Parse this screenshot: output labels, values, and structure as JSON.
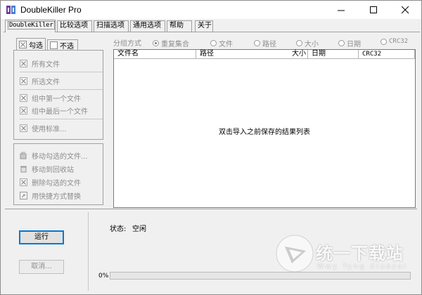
{
  "window": {
    "title": "DoubleKiller Pro"
  },
  "tabs": [
    {
      "label": "DoubleKiller"
    },
    {
      "label": "比较选项"
    },
    {
      "label": "扫描选项"
    },
    {
      "label": "通用选项"
    },
    {
      "label": "帮助"
    },
    {
      "label": "关于"
    }
  ],
  "select_tabs": {
    "check": "勾选",
    "uncheck": "不选"
  },
  "check_menu": [
    {
      "label": "所有文件",
      "icon": "checkbox-x-icon"
    },
    {
      "label": "所选文件",
      "icon": "checkbox-x-icon"
    },
    {
      "label": "组中第一个文件",
      "icon": "checkbox-x-icon"
    },
    {
      "label": "组中最后一个文件",
      "icon": "checkbox-x-icon"
    },
    {
      "label": "使用标准...",
      "icon": "checkbox-x-icon"
    }
  ],
  "action_menu": [
    {
      "label": "移动勾选的文件...",
      "icon": "move-files-icon"
    },
    {
      "label": "移动到回收站",
      "icon": "recycle-bin-icon"
    },
    {
      "label": "删除勾选的文件",
      "icon": "delete-icon"
    },
    {
      "label": "用快捷方式替换",
      "icon": "shortcut-icon"
    }
  ],
  "grouping": {
    "label": "分组方式",
    "options": [
      {
        "label": "重复集合",
        "selected": true
      },
      {
        "label": "文件",
        "selected": false
      },
      {
        "label": "路径",
        "selected": false
      },
      {
        "label": "大小",
        "selected": false
      },
      {
        "label": "日期",
        "selected": false
      },
      {
        "label": "CRC32",
        "selected": false
      }
    ]
  },
  "results": {
    "columns": [
      "文件名",
      "路径",
      "大小",
      "日期",
      "CRC32"
    ],
    "empty_message": "双击导入之前保存的结果列表"
  },
  "buttons": {
    "run": "运行",
    "cancel": "取消..."
  },
  "status": {
    "label": "状态:",
    "value": "空闲",
    "progress_text": "0%",
    "progress": 0
  },
  "watermark": {
    "text": "统一下载站",
    "subtext": "Wwy Tyng Xiaazai"
  }
}
